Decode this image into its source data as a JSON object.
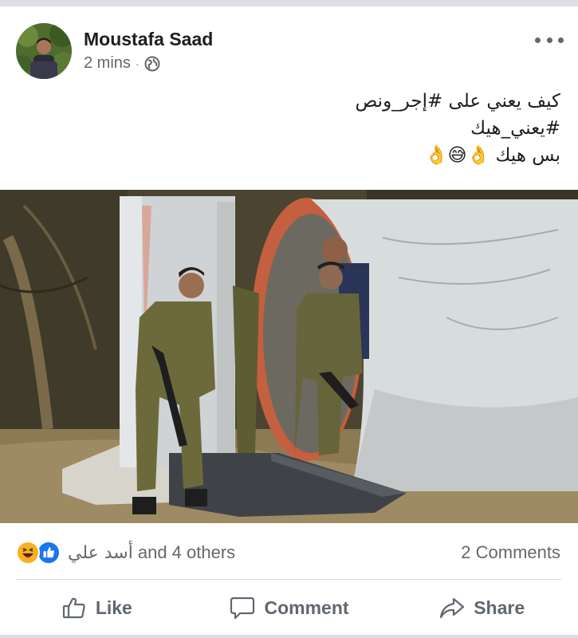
{
  "post": {
    "author": "Moustafa Saad",
    "time": "2 mins",
    "separator": "·",
    "privacy_icon": "globe-icon",
    "text_lines": [
      "كيف يعني على #إجر_ونص",
      "#يعني_هيك",
      "بس هيك 👌😅👌"
    ]
  },
  "reactions": {
    "icons": [
      "haha-reaction-icon",
      "like-reaction-icon"
    ],
    "name": "أسد علي",
    "others": "and 4 others",
    "comments": "2 Comments"
  },
  "actions": {
    "like": "Like",
    "comment": "Comment",
    "share": "Share"
  },
  "colors": {
    "text_primary": "#1c1e21",
    "text_secondary": "#65676b",
    "like_blue": "#1877f2",
    "haha_yellow": "#f7b125",
    "divider": "#dadde1"
  }
}
